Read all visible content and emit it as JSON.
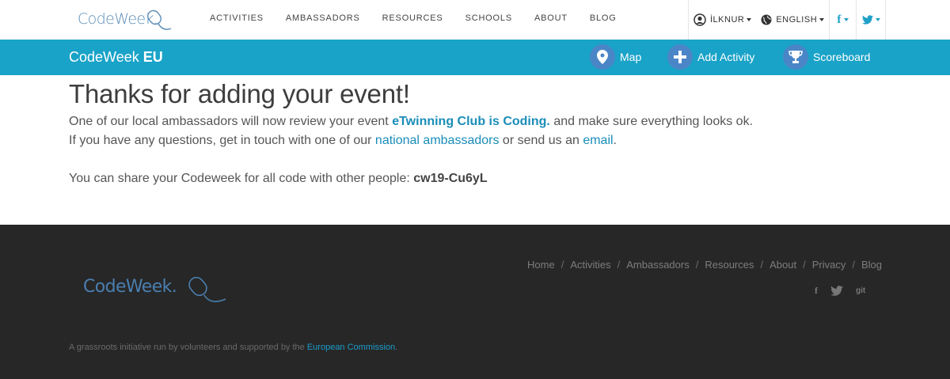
{
  "header": {
    "logo_text": "CodeWeek.",
    "menu": [
      "ACTIVITIES",
      "AMBASSADORS",
      "RESOURCES",
      "SCHOOLS",
      "ABOUT",
      "BLOG"
    ],
    "user_label": "İLKNUR",
    "language_label": "ENGLISH",
    "facebook_label": "f",
    "twitter_icon": "twitter-icon"
  },
  "bluebar": {
    "brand_light": "CodeWeek",
    "brand_bold": "EU",
    "map_label": "Map",
    "add_activity_label": "Add Activity",
    "scoreboard_label": "Scoreboard",
    "color": "#1aa3c8",
    "circle_color": "#4a86c7"
  },
  "main": {
    "heading": "Thanks for adding your event!",
    "line1_pre": "One of our local ambassadors will now review your event ",
    "event_link": "eTwinning Club is Coding.",
    "line1_post": " and make sure everything looks ok.",
    "line2_pre": "If you have any questions, get in touch with one of our ",
    "ambassadors_link": "national ambassadors",
    "line2_mid": " or send us an ",
    "email_link": "email",
    "line2_post": ".",
    "share_text": "You can share your Codeweek for all code with other people: ",
    "share_code": "cw19-Cu6yL",
    "link_color": "#1a8db8"
  },
  "footer": {
    "links": [
      "Home",
      "Activities",
      "Ambassadors",
      "Resources",
      "About",
      "Privacy",
      "Blog"
    ],
    "separator": "/",
    "social": [
      "f",
      "twitter",
      "git"
    ],
    "logo_text": "CodeWeek.",
    "note_pre": "A grassroots initiative run by volunteers and supported by the ",
    "note_link": "European Commission",
    "note_post": ".",
    "bg": "#272727"
  }
}
